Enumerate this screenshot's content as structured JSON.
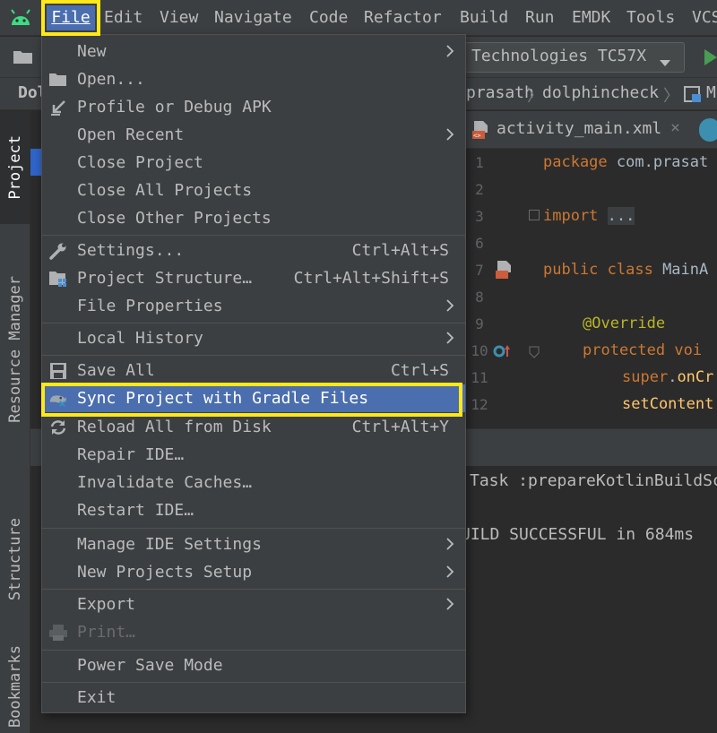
{
  "menubar": {
    "items": [
      {
        "label": "File",
        "mnemonic": "F"
      },
      {
        "label": "Edit"
      },
      {
        "label": "View"
      },
      {
        "label": "Navigate"
      },
      {
        "label": "Code"
      },
      {
        "label": "Refactor"
      },
      {
        "label": "Build"
      },
      {
        "label": "Run"
      },
      {
        "label": "EMDK"
      },
      {
        "label": "Tools"
      },
      {
        "label": "VCS"
      }
    ]
  },
  "toolbar": {
    "device_selector": "Technologies TC57X"
  },
  "navbar": {
    "project": "Dol",
    "crumbs": [
      "prasath",
      "dolphincheck",
      "M"
    ]
  },
  "editor_tabs": [
    {
      "label": "activity_main.xml"
    }
  ],
  "left_strip": {
    "tabs": [
      "Project",
      "Resource Manager",
      "Structure",
      "Bookmarks"
    ]
  },
  "editor": {
    "lines": [
      {
        "num": "1",
        "text": "package com.prasat"
      },
      {
        "num": "2",
        "text": ""
      },
      {
        "num": "3",
        "text": "import ..."
      },
      {
        "num": "6",
        "text": ""
      },
      {
        "num": "7",
        "text": "public class MainA"
      },
      {
        "num": "8",
        "text": ""
      },
      {
        "num": "9",
        "text": "@Override"
      },
      {
        "num": "10",
        "text": "protected voi"
      },
      {
        "num": "11",
        "text": "super.onCr"
      },
      {
        "num": "12",
        "text": "setContent"
      }
    ]
  },
  "run_output": {
    "task_line": "Task :prepareKotlinBuildSc",
    "result_line": "UILD SUCCESSFUL in 684ms"
  },
  "file_menu": {
    "items": {
      "new": {
        "label": "New"
      },
      "open": {
        "label": "Open..."
      },
      "profile": {
        "label": "Profile or Debug APK"
      },
      "open_recent": {
        "label": "Open Recent"
      },
      "close_project": {
        "label": "Close Project"
      },
      "close_all": {
        "label": "Close All Projects"
      },
      "close_other": {
        "label": "Close Other Projects"
      },
      "settings": {
        "label": "Settings...",
        "shortcut": "Ctrl+Alt+S"
      },
      "project_structure": {
        "label": "Project Structure…",
        "shortcut": "Ctrl+Alt+Shift+S"
      },
      "file_properties": {
        "label": "File Properties"
      },
      "local_history": {
        "label": "Local History"
      },
      "save_all": {
        "label": "Save All",
        "shortcut": "Ctrl+S"
      },
      "sync_gradle": {
        "label": "Sync Project with Gradle Files"
      },
      "reload": {
        "label": "Reload All from Disk",
        "shortcut": "Ctrl+Alt+Y"
      },
      "repair": {
        "label": "Repair IDE…"
      },
      "invalidate": {
        "label": "Invalidate Caches…"
      },
      "restart": {
        "label": "Restart IDE…"
      },
      "manage_settings": {
        "label": "Manage IDE Settings"
      },
      "new_projects_setup": {
        "label": "New Projects Setup"
      },
      "export": {
        "label": "Export"
      },
      "print": {
        "label": "Print…"
      },
      "power_save": {
        "label": "Power Save Mode"
      },
      "exit": {
        "label": "Exit"
      }
    }
  },
  "colors": {
    "menu_bg": "#3c3f41",
    "selection": "#4b6eaf",
    "highlight_box": "#ffe81a",
    "android_green": "#3ddc84"
  }
}
